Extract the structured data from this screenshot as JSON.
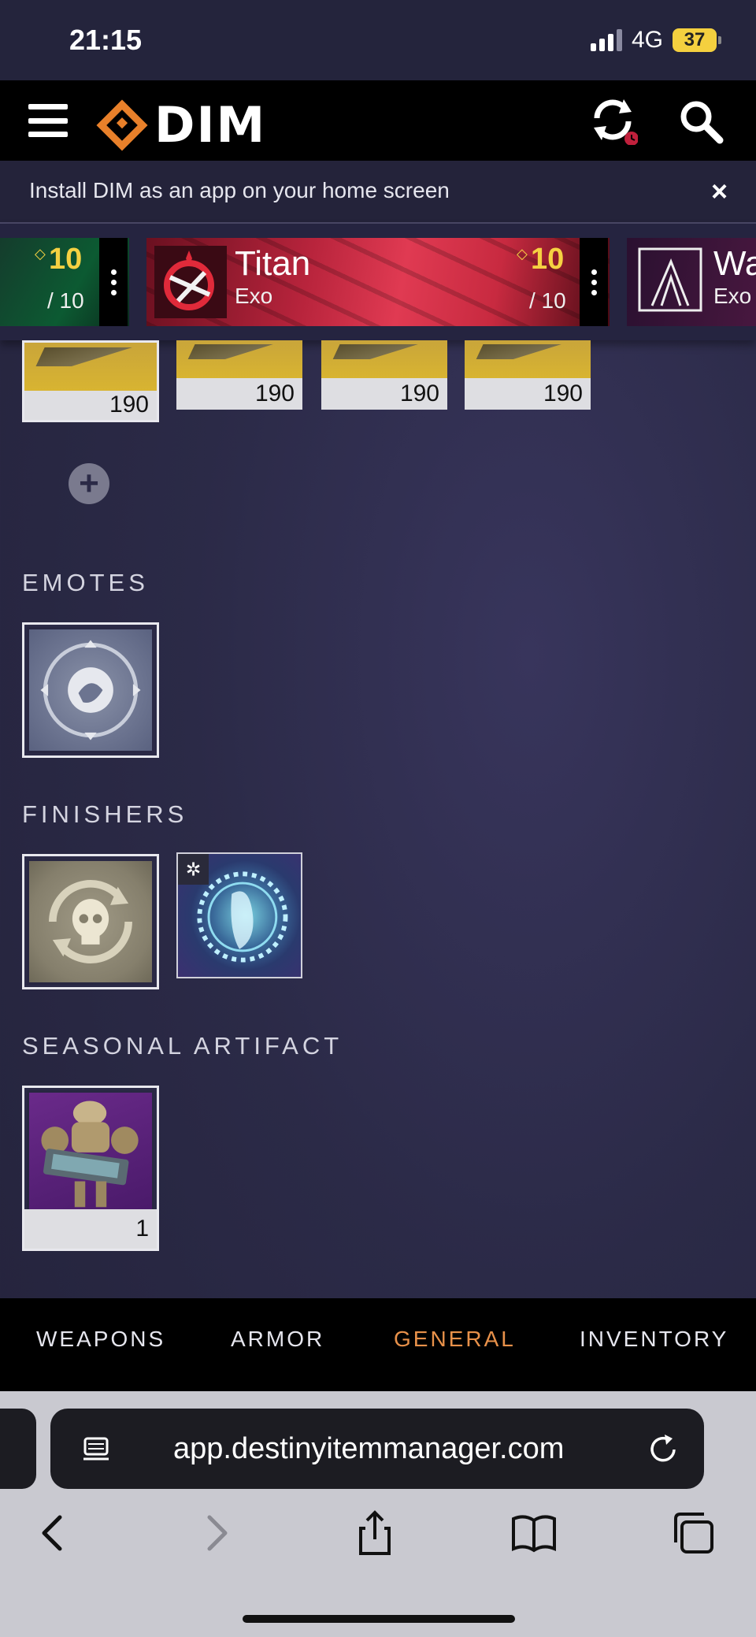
{
  "status_bar": {
    "time": "21:15",
    "network": "4G",
    "battery": "37"
  },
  "header": {
    "app_name": "DIM"
  },
  "banner": {
    "text": "Install DIM as an app on your home screen",
    "close": "×"
  },
  "characters": [
    {
      "power": "10",
      "power_max": "/ 10"
    },
    {
      "class": "Titan",
      "race": "Exo",
      "power": "10",
      "power_max": "/ 10"
    },
    {
      "class": "Wa",
      "race": "Exo"
    }
  ],
  "weapons_row": {
    "items": [
      "190",
      "190",
      "190",
      "190"
    ]
  },
  "sections": {
    "emotes": "EMOTES",
    "finishers": "FINISHERS",
    "seasonal_artifact": "SEASONAL ARTIFACT"
  },
  "artifact": {
    "count": "1"
  },
  "tabs": [
    {
      "label": "WEAPONS",
      "active": false
    },
    {
      "label": "ARMOR",
      "active": false
    },
    {
      "label": "GENERAL",
      "active": true
    },
    {
      "label": "INVENTORY",
      "active": false
    }
  ],
  "browser": {
    "url": "app.destinyitemmanager.com"
  },
  "colors": {
    "accent": "#e8914a",
    "power": "#f5d142",
    "background": "#2b2a47"
  }
}
